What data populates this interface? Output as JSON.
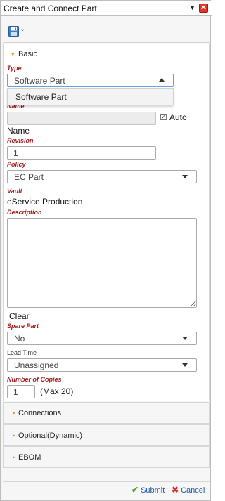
{
  "header": {
    "title": "Create and Connect Part",
    "caret": "▼",
    "close": "✕"
  },
  "toolbar": {
    "save_caret": "⌄"
  },
  "sections": {
    "basic": {
      "label": "Basic",
      "arrow": "▾"
    },
    "connections": {
      "label": "Connections",
      "arrow": "▸"
    },
    "optional": {
      "label": "Optional(Dynamic)",
      "arrow": "▸"
    },
    "ebom": {
      "label": "EBOM",
      "arrow": "▸"
    }
  },
  "form": {
    "type": {
      "label": "Type",
      "value": "Software Part",
      "options": [
        "Software Part"
      ]
    },
    "name": {
      "label": "Name",
      "value": "",
      "auto_label": "Auto",
      "auto_checked": true,
      "caption": "Name"
    },
    "revision": {
      "label": "Revision",
      "value": "1"
    },
    "policy": {
      "label": "Policy",
      "value": "EC Part"
    },
    "vault": {
      "label": "Vault",
      "value": "eService Production"
    },
    "description": {
      "label": "Description",
      "value": "",
      "clear_label": "Clear"
    },
    "spare_part": {
      "label": "Spare Part",
      "value": "No"
    },
    "lead_time": {
      "label": "Lead Time",
      "value": "Unassigned"
    },
    "copies": {
      "label": "Number of Copies",
      "value": "1",
      "max_note": "(Max 20)"
    }
  },
  "footer": {
    "submit_label": "Submit",
    "cancel_label": "Cancel",
    "submit_icon": "✔",
    "cancel_icon": "✖"
  }
}
